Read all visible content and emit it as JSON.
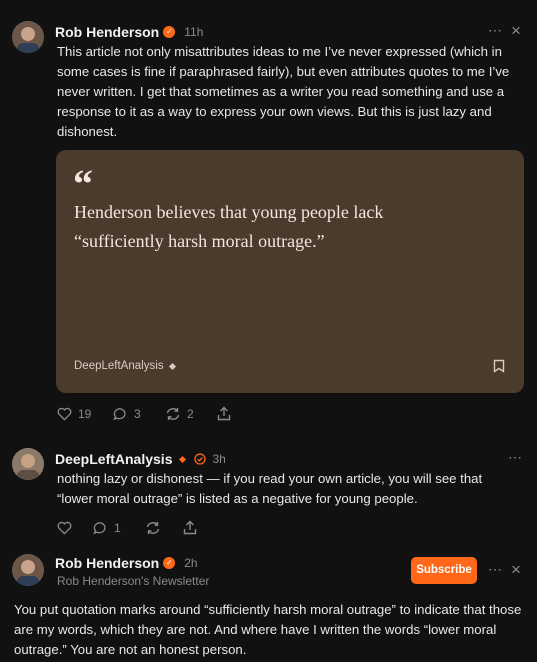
{
  "comments": [
    {
      "author": "Rob Henderson",
      "time": "11h",
      "text": "This article not only misattributes ideas to me I’ve never expressed (which in some cases is fine if paraphrased fairly), but even attributes quotes to me I’ve never written. I get that sometimes as a writer you read something and use a response to it as a way to express your own views. But this is just lazy and dishonest.",
      "quote": {
        "mark": "“",
        "text": "Henderson believes that young people lack “sufficiently harsh moral outrage.”",
        "source": "DeepLeftAnalysis"
      },
      "actions": {
        "likes": "19",
        "replies": "3",
        "restacks": "2"
      }
    },
    {
      "author": "DeepLeftAnalysis",
      "time": "3h",
      "text": "nothing lazy or dishonest — if you read your own article, you will see that “lower moral outrage” is listed as a negative for young people.",
      "actions": {
        "replies": "1"
      }
    },
    {
      "author": "Rob Henderson",
      "time": "2h",
      "newsletter": "Rob Henderson's Newsletter",
      "subscribe_label": "Subscribe",
      "text": "You put quotation marks around “sufficiently harsh moral outrage” to indicate that those are my words, which they are not. And where have I written the words “lower moral outrage.” You are not an honest person."
    }
  ],
  "icons": {
    "more": "⋯",
    "close": "×",
    "verified_badge": "✓"
  },
  "colors": {
    "accent": "#ff6719",
    "background": "#111111",
    "quote_card": "#4a3b2c"
  }
}
